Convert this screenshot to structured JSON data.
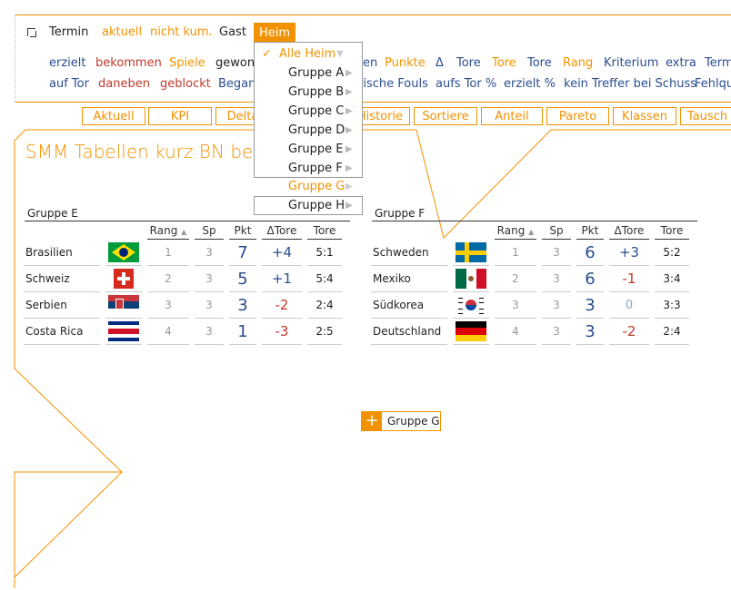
{
  "nav_main": {
    "items": [
      "Termin",
      "aktuell",
      "nicht kum.",
      "Gast",
      "Heim"
    ]
  },
  "nav_row2": [
    "erzielt",
    "bekommen",
    "Spiele",
    "gewon",
    "en",
    "Punkte",
    "Δ",
    "Tore",
    "Tore",
    "Tore",
    "Rang",
    "Kriterium",
    "extra",
    "Term"
  ],
  "nav_row3": [
    "auf Tor",
    "daneben",
    "geblockt",
    "Began",
    "rische Fouls",
    "aufs Tor %",
    "erzielt %",
    "kein Treffer bei Schuss",
    "Fehlqu"
  ],
  "tabs": [
    "Aktuell",
    "KPI",
    "Delta",
    "Historie",
    "Sortiere",
    "Anteil",
    "Pareto",
    "Klassen",
    "Tausch"
  ],
  "title": "SMM Tabellen kurz BN bei",
  "dropdown": {
    "items": [
      "Alle Heim",
      "Gruppe A",
      "Gruppe B",
      "Gruppe C",
      "Gruppe D",
      "Gruppe E",
      "Gruppe F",
      "Gruppe G",
      "Gruppe H"
    ],
    "checked": "✓"
  },
  "headers": {
    "rang": "Rang",
    "sp": "Sp",
    "pkt": "Pkt",
    "dtore": "ΔTore",
    "tore": "Tore"
  },
  "group_e": {
    "name": "Gruppe E",
    "rows": [
      {
        "team": "Brasilien",
        "flag": "brazil",
        "rang": "1",
        "sp": "3",
        "pkt": "7",
        "dtore": "+4",
        "tore": "5:1"
      },
      {
        "team": "Schweiz",
        "flag": "switzerland",
        "rang": "2",
        "sp": "3",
        "pkt": "5",
        "dtore": "+1",
        "tore": "5:4"
      },
      {
        "team": "Serbien",
        "flag": "serbia",
        "rang": "3",
        "sp": "3",
        "pkt": "3",
        "dtore": "-2",
        "tore": "2:4"
      },
      {
        "team": "Costa Rica",
        "flag": "costa-rica",
        "rang": "4",
        "sp": "3",
        "pkt": "1",
        "dtore": "-3",
        "tore": "2:5"
      }
    ]
  },
  "group_f": {
    "name": "Gruppe F",
    "rows": [
      {
        "team": "Schweden",
        "flag": "sweden",
        "rang": "1",
        "sp": "3",
        "pkt": "6",
        "dtore": "+3",
        "tore": "5:2"
      },
      {
        "team": "Mexiko",
        "flag": "mexico",
        "rang": "2",
        "sp": "3",
        "pkt": "6",
        "dtore": "-1",
        "tore": "3:4"
      },
      {
        "team": "Südkorea",
        "flag": "south-korea",
        "rang": "3",
        "sp": "3",
        "pkt": "3",
        "dtore": "0",
        "tore": "3:3"
      },
      {
        "team": "Deutschland",
        "flag": "germany",
        "rang": "4",
        "sp": "3",
        "pkt": "3",
        "dtore": "-2",
        "tore": "2:4"
      }
    ]
  },
  "add_button": {
    "icon": "+",
    "label": "Gruppe G"
  },
  "colors": {
    "accent": "#f39200",
    "positive": "#2a4d8f",
    "negative": "#c0392b"
  }
}
